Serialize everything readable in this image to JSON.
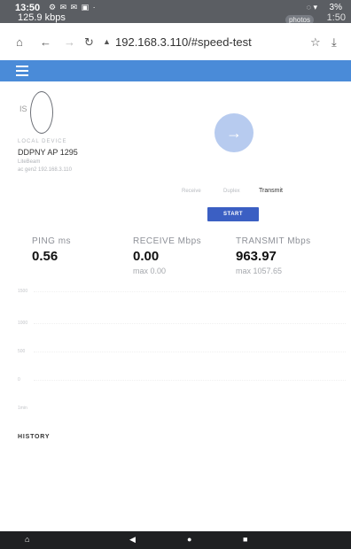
{
  "status_bar": {
    "time": "13:50",
    "notifications": "⚙ ✉ ✉ ▣ ·",
    "network_speed": "125.9 kbps",
    "right_icons": "◌ ▾",
    "battery": "3%",
    "overlay_time": "1:50",
    "overlay_badge": "photos"
  },
  "browser": {
    "home_icon": "home-icon",
    "back_icon": "back-icon",
    "forward_icon": "forward-icon",
    "reload_icon": "reload-icon",
    "url": "192.168.3.110/#speed-test",
    "bookmark_icon": "star-icon",
    "download_icon": "download-icon"
  },
  "device": {
    "dish_mark": "IS",
    "section_label": "LOCAL DEVICE",
    "name": "DDPNY AP 1295",
    "sub_lines": [
      "LiteBeam",
      "ac gen2 192.168.3.110"
    ]
  },
  "modes": {
    "items": [
      "Receive",
      "Duplex",
      "Transmit"
    ],
    "active": "Transmit"
  },
  "start_button": {
    "label": "START"
  },
  "stats": {
    "ping": {
      "label": "PING ms",
      "value": "0.56"
    },
    "receive": {
      "label": "RECEIVE Mbps",
      "value": "0.00",
      "max": "max 0.00"
    },
    "transmit": {
      "label": "TRANSMIT Mbps",
      "value": "963.97",
      "max": "max 1057.65"
    }
  },
  "chart_axis_ticks": [
    "1500",
    "1000",
    "500",
    "0",
    "1min"
  ],
  "history": {
    "label": "HISTORY"
  },
  "nav_bar": {
    "menu_icon": "menu-icon",
    "back_icon": "back-triangle-icon",
    "home_icon": "home-dot-icon",
    "recents_icon": "recents-square-icon"
  },
  "colors": {
    "app_bar": "#4a8bd8",
    "start_button": "#3b5fc3",
    "go_button": "#b7cbef",
    "status_bar": "#5b5e63",
    "nav_bar": "#1f2022"
  }
}
